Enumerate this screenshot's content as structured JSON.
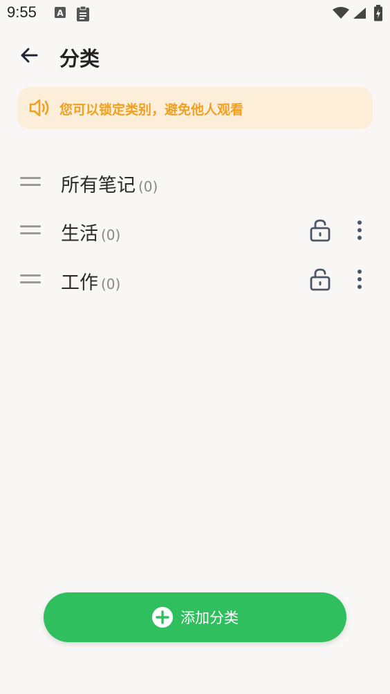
{
  "status_bar": {
    "time": "9:55",
    "icons": [
      "a-letter-icon",
      "clipboard-icon",
      "wifi-icon",
      "cell-signal-icon",
      "battery-charging-icon"
    ]
  },
  "app_bar": {
    "back_icon": "arrow-left-icon",
    "title": "分类"
  },
  "notice": {
    "icon": "speaker-icon",
    "text": "您可以锁定类别，避免他人观看",
    "color": "#f0a020",
    "background": "#fdeed9"
  },
  "categories": [
    {
      "name": "所有笔记",
      "count": "(0)",
      "lockable": false
    },
    {
      "name": "生活",
      "count": "(0)",
      "lockable": true
    },
    {
      "name": "工作",
      "count": "(0)",
      "lockable": true
    }
  ],
  "add_button": {
    "label": "添加分类",
    "icon": "plus-circle-icon",
    "color": "#2fbf5f"
  }
}
